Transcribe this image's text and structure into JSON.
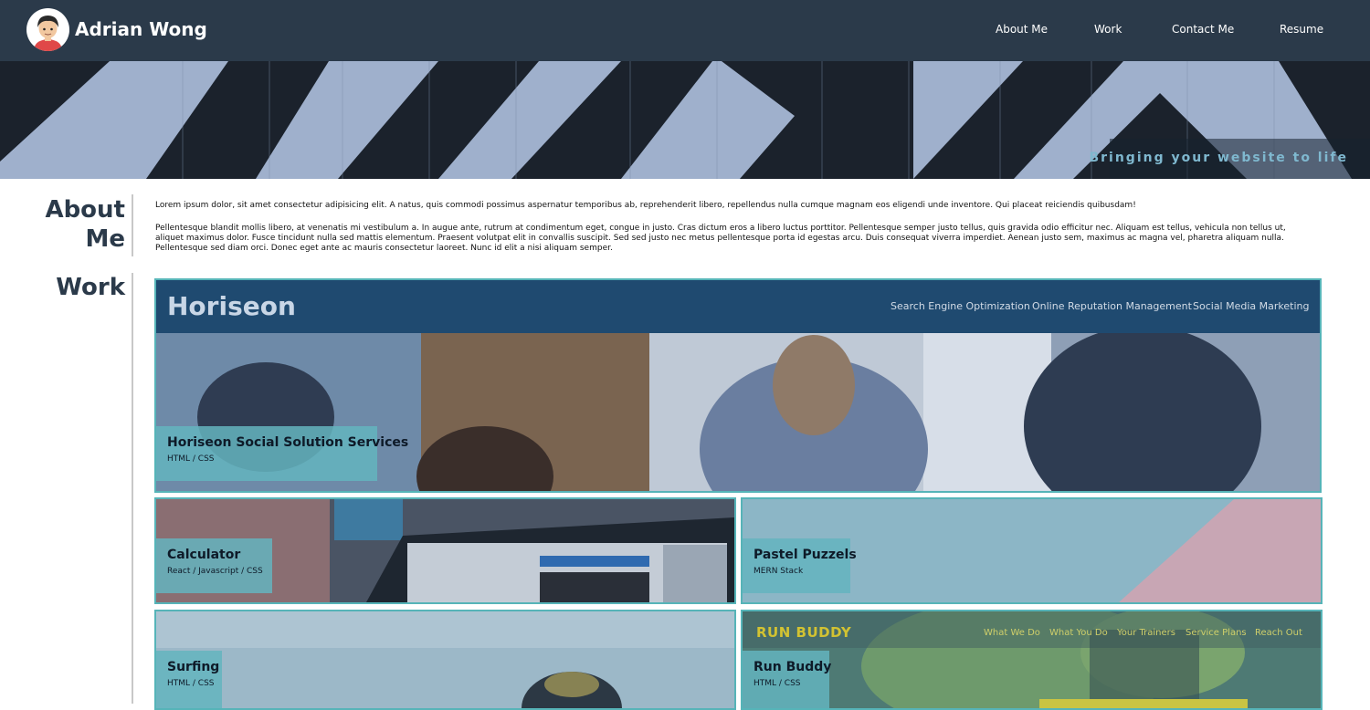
{
  "header": {
    "name": "Adrian Wong",
    "nav": [
      "About Me",
      "Work",
      "Contact Me",
      "Resume"
    ]
  },
  "hero": {
    "tagline": "Bringing your website to life"
  },
  "about": {
    "title_line1": "About",
    "title_line2": "Me",
    "paragraph1": "Lorem ipsum dolor, sit amet consectetur adipisicing elit. A natus, quis commodi possimus aspernatur temporibus ab, reprehenderit libero, repellendus nulla cumque magnam eos eligendi unde inventore. Qui placeat reiciendis quibusdam!",
    "paragraph2": "Pellentesque blandit mollis libero, at venenatis mi vestibulum a. In augue ante, rutrum at condimentum eget, congue in justo. Cras dictum eros a libero luctus porttitor. Pellentesque semper justo tellus, quis gravida odio efficitur nec. Aliquam est tellus, vehicula non tellus ut, aliquet maximus dolor. Fusce tincidunt nulla sed mattis elementum. Praesent volutpat elit in convallis suscipit. Sed sed justo nec metus pellentesque porta id egestas arcu. Duis consequat viverra imperdiet. Aenean justo sem, maximus ac magna vel, pharetra aliquam nulla. Pellentesque sed diam orci. Donec eget ante ac mauris consectetur laoreet. Nunc id elit a nisi aliquam semper."
  },
  "work": {
    "title": "Work",
    "projects": [
      {
        "title": "Horiseon Social Solution Services",
        "tech": "HTML / CSS"
      },
      {
        "title": "Calculator",
        "tech": "React / Javascript / CSS"
      },
      {
        "title": "Pastel Puzzels",
        "tech": "MERN Stack"
      },
      {
        "title": "Surfing",
        "tech": "HTML / CSS"
      },
      {
        "title": "Run Buddy",
        "tech": "HTML / CSS"
      }
    ],
    "horiseon_preview": {
      "logo": "Horiseon",
      "nav": [
        "Search Engine Optimization",
        "Online Reputation Management",
        "Social Media Marketing"
      ]
    },
    "runbuddy_preview": {
      "logo": "RUN BUDDY",
      "nav": [
        "What We Do",
        "What You Do",
        "Your Trainers",
        "Service Plans",
        "Reach Out"
      ]
    }
  },
  "colors": {
    "header_bg": "#2b3a4a",
    "accent_teal": "#56b4b8",
    "tagline": "#7fb8cf",
    "horiseon_bar": "#1f4a70"
  },
  "icons": {
    "avatar": "avatar-icon"
  }
}
